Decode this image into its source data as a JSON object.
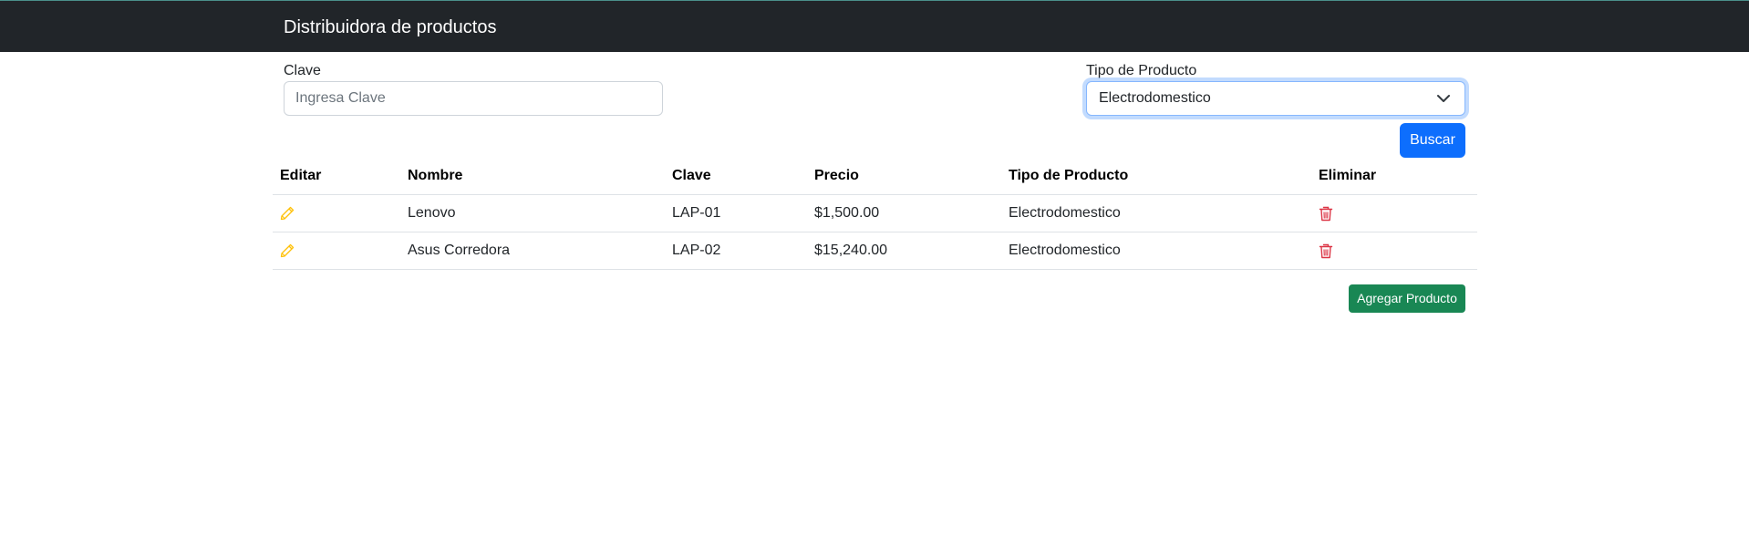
{
  "navbar": {
    "brand": "Distribuidora de productos"
  },
  "filters": {
    "clave_label": "Clave",
    "clave_placeholder": "Ingresa Clave",
    "clave_value": "",
    "tipo_label": "Tipo de Producto",
    "tipo_selected": "Electrodomestico",
    "buscar_label": "Buscar"
  },
  "table": {
    "headers": [
      "Editar",
      "Nombre",
      "Clave",
      "Precio",
      "Tipo de Producto",
      "Eliminar"
    ],
    "rows": [
      {
        "nombre": "Lenovo",
        "clave": "LAP-01",
        "precio": "$1,500.00",
        "tipo": "Electrodomestico"
      },
      {
        "nombre": "Asus Corredora",
        "clave": "LAP-02",
        "precio": "$15,240.00",
        "tipo": "Electrodomestico"
      }
    ]
  },
  "actions": {
    "agregar_label": "Agregar Producto"
  },
  "icons": {
    "edit": "pencil-icon",
    "delete": "trash-icon",
    "select": "chevron-down-icon"
  },
  "colors": {
    "navbar_bg": "#212529",
    "primary": "#0d6efd",
    "success": "#198754",
    "warning": "#ffc107",
    "danger": "#dc3545"
  }
}
